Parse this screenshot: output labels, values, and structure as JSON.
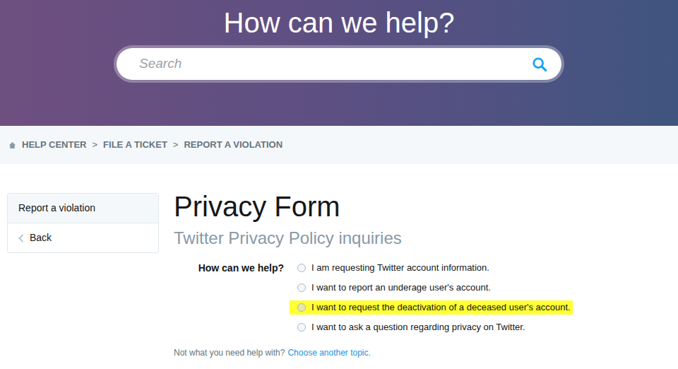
{
  "hero": {
    "title": "How can we help?",
    "search": {
      "placeholder": "Search"
    }
  },
  "breadcrumb": {
    "separator": ">",
    "items": [
      {
        "label": "HELP CENTER"
      },
      {
        "label": "FILE A TICKET"
      },
      {
        "label": "REPORT A VIOLATION"
      }
    ]
  },
  "sidebar": {
    "items": [
      {
        "label": "Report a violation",
        "kind": "header"
      },
      {
        "label": "Back",
        "kind": "back"
      }
    ]
  },
  "form": {
    "title": "Privacy Form",
    "subtitle": "Twitter Privacy Policy inquiries",
    "question": "How can we help?",
    "options": [
      {
        "label": "I am requesting Twitter account information.",
        "selected": false,
        "highlighted": false
      },
      {
        "label": "I want to report an underage user's account.",
        "selected": false,
        "highlighted": false
      },
      {
        "label": "I want to request the deactivation of a deceased user's account.",
        "selected": false,
        "highlighted": true
      },
      {
        "label": "I want to ask a question regarding privacy on Twitter.",
        "selected": false,
        "highlighted": false
      }
    ]
  },
  "footer": {
    "text": "Not what you need help with?",
    "link": "Choose another topic."
  }
}
